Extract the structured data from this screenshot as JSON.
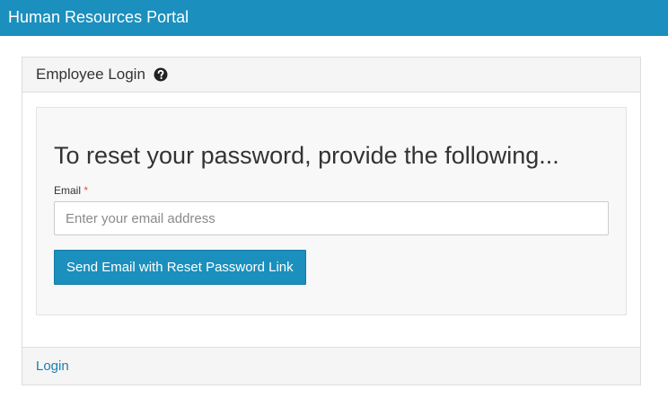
{
  "app": {
    "title": "Human Resources Portal"
  },
  "panel": {
    "header_title": "Employee Login",
    "help_icon": "question-circle-icon"
  },
  "form": {
    "heading": "To reset your password, provide the following...",
    "email_label": "Email",
    "required_marker": "*",
    "email_value": "",
    "email_placeholder": "Enter your email address",
    "submit_label": "Send Email with Reset Password Link"
  },
  "footer": {
    "login_link": "Login"
  },
  "colors": {
    "brand": "#1b8fbd",
    "link": "#1b7fb0",
    "required": "#d9534f"
  }
}
